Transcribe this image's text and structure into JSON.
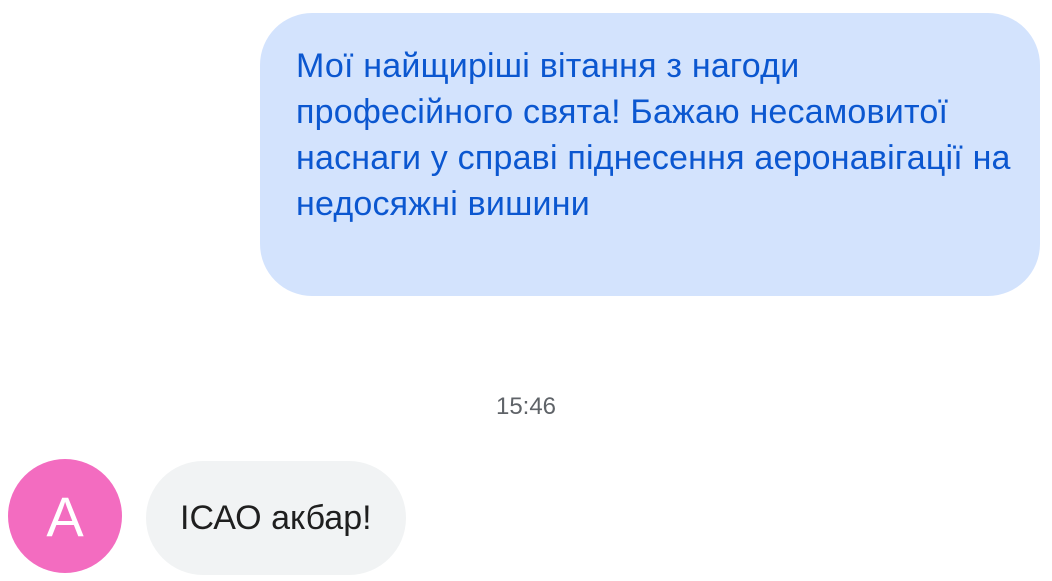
{
  "conversation": {
    "outgoing_message": {
      "text": "Мої найщиріші вітання з нагоди професійного свята! Бажаю несамовитої наснаги у справі піднесення аеронавігації на недосяжні вишини",
      "bubble_color": "#d3e3fd",
      "text_color": "#0b57d0"
    },
    "timestamp": "15:46",
    "incoming_message": {
      "sender_initial": "А",
      "avatar_color": "#f36cc0",
      "text": "ІСАО акбар!",
      "bubble_color": "#f1f3f4"
    }
  }
}
